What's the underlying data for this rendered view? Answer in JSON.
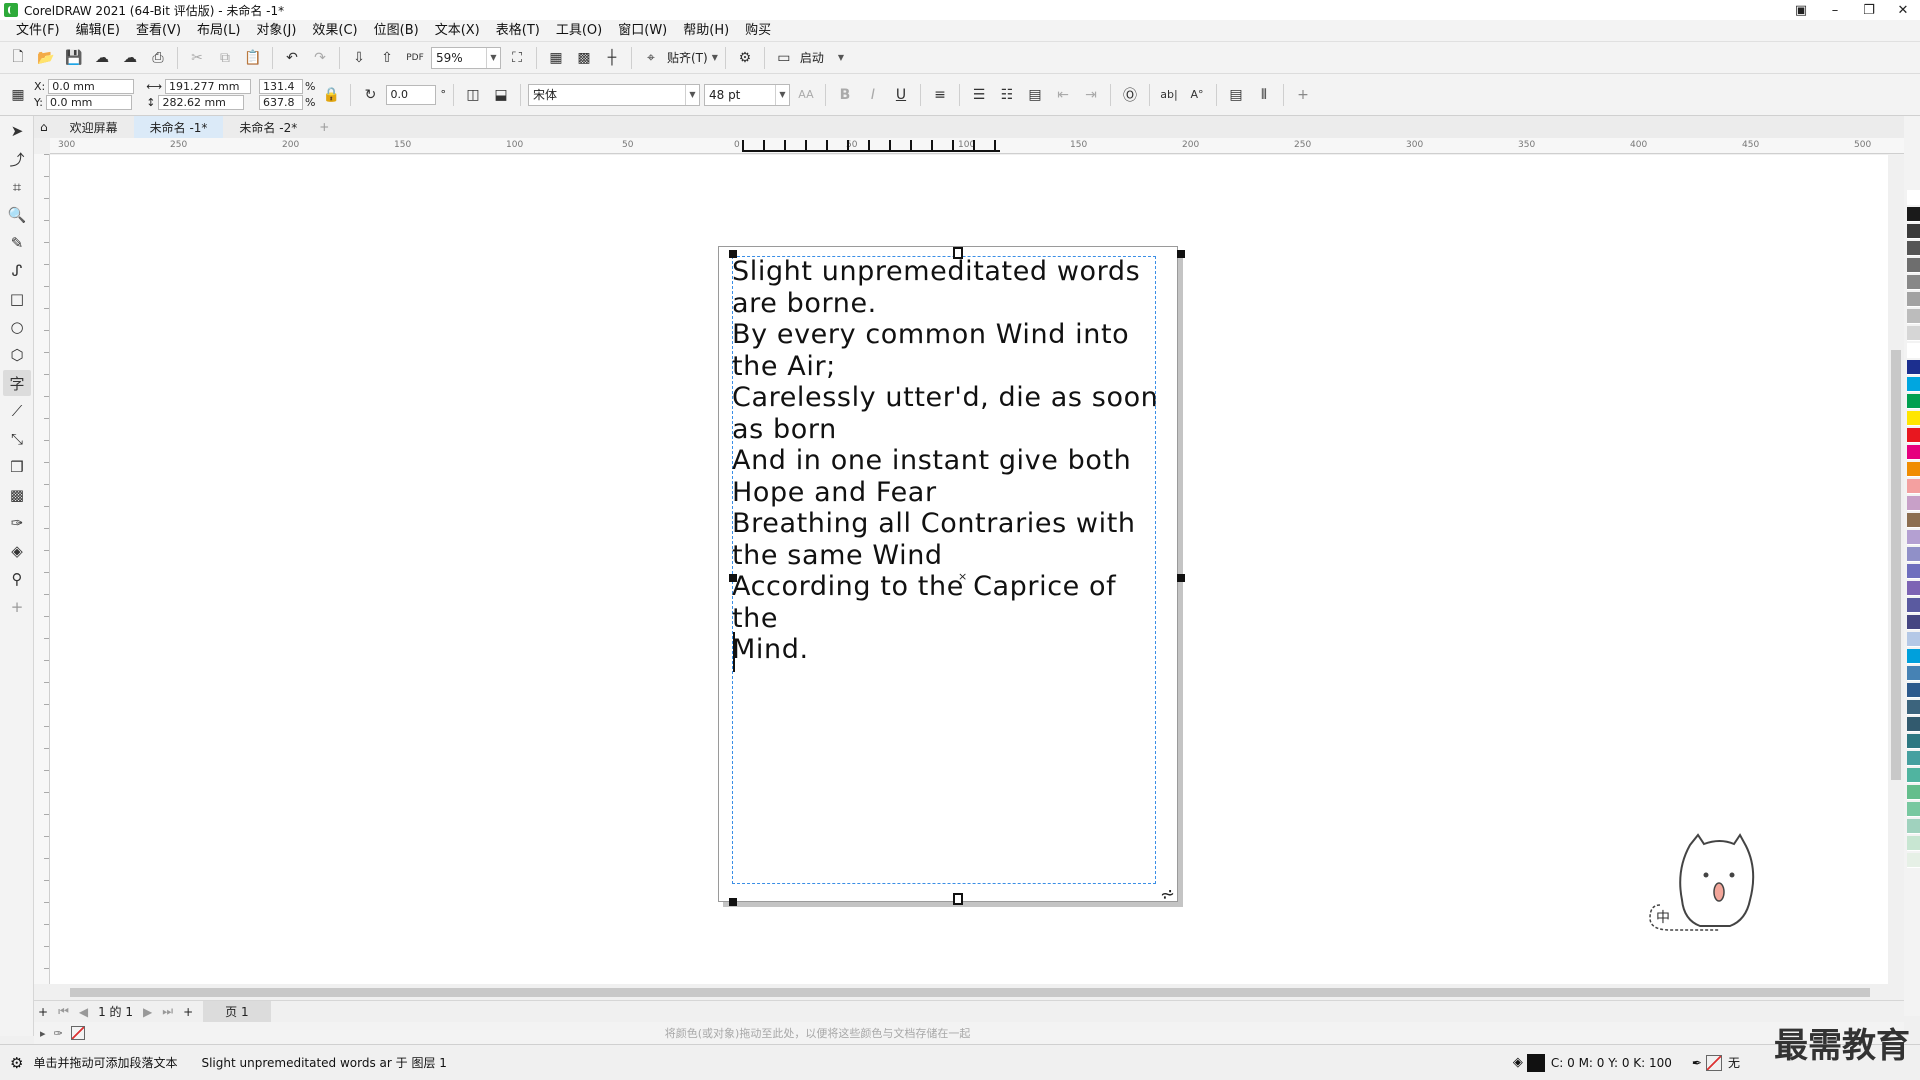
{
  "window": {
    "title": "CorelDRAW 2021 (64-Bit 评估版) - 未命名 -1*"
  },
  "menu": [
    "文件(F)",
    "编辑(E)",
    "查看(V)",
    "布局(L)",
    "对象(J)",
    "效果(C)",
    "位图(B)",
    "文本(X)",
    "表格(T)",
    "工具(O)",
    "窗口(W)",
    "帮助(H)",
    "购买"
  ],
  "toolbar1": {
    "zoom": "59%",
    "snap_label": "贴齐(T)",
    "launch_label": "启动"
  },
  "toolbar2": {
    "x_label": "X:",
    "x_value": "0.0 mm",
    "y_label": "Y:",
    "y_value": "0.0 mm",
    "w_value": "191.277 mm",
    "h_value": "282.62 mm",
    "scale_w": "131.4",
    "scale_h": "637.8",
    "pct": "%",
    "rotation": "0.0",
    "font_name": "宋体",
    "font_size": "48 pt"
  },
  "tabs": {
    "home_icon": "home-icon",
    "items": [
      "欢迎屏幕",
      "未命名 -1*",
      "未命名 -2*"
    ],
    "active": 1,
    "add": "+"
  },
  "ruler": {
    "h_labels": [
      "300",
      "250",
      "200",
      "150",
      "100",
      "50",
      "0",
      "50",
      "100",
      "150",
      "200",
      "250",
      "300",
      "350",
      "400",
      "450",
      "500"
    ],
    "units": "毫米"
  },
  "document": {
    "text_lines": [
      "Slight unpremeditated words",
      "are borne.",
      "By every common Wind into",
      "the Air;",
      "Carelessly utter'd, die as soon",
      "as born",
      "And in one instant give both",
      "Hope and Fear",
      "Breathing all Contraries with",
      "the same Wind",
      "According to the Caprice of the",
      "Mind."
    ]
  },
  "pagenav": {
    "page_count": "1 的 1",
    "page_tab": "页 1"
  },
  "color_hint": "将颜色(或对象)拖动至此处，以便将这些颜色与文档存储在一起",
  "status": {
    "hint": "单击并拖动可添加段落文本",
    "object_info": "Slight unpremeditated words ar 于 图层 1",
    "fill_cmyk": "C: 0 M: 0 Y: 0 K: 100",
    "outline": "无"
  },
  "colors": {
    "accent": "#3a8ee6",
    "palette": [
      "#ffffff",
      "#1a1a1a",
      "#3a3a3a",
      "#555555",
      "#6e6e6e",
      "#888888",
      "#a2a2a2",
      "#bcbcbc",
      "#d6d6d6",
      "#ffffff",
      "#1c2f8f",
      "#00a6e0",
      "#00a050",
      "#ffe600",
      "#e8171f",
      "#e6007e",
      "#f08c00",
      "#f4a0a0",
      "#c8a0c8",
      "#8c6e50",
      "#b4a0d2",
      "#9090c8",
      "#6e6ebe",
      "#7d64b4",
      "#5a5aa0",
      "#464682",
      "#b4c8e6",
      "#00a0dc",
      "#4682b4",
      "#2d5a8c",
      "#3c647d",
      "#325a6e",
      "#2d7882",
      "#46a0a0",
      "#50b4a0",
      "#64be8c",
      "#78c8a0",
      "#a0d2be",
      "#c8e6d2",
      "#e6f0e6"
    ]
  },
  "watermark": "最需教育"
}
